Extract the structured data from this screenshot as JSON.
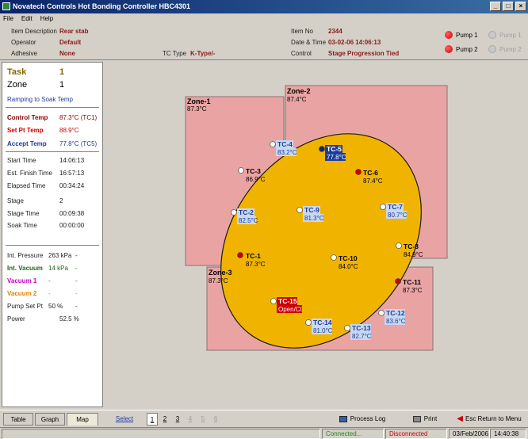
{
  "window": {
    "title": "Novatech Controls Hot Bonding Controller HBC4301"
  },
  "menu": [
    "File",
    "Edit",
    "Help"
  ],
  "header": {
    "item_description_label": "Item Description",
    "item_description": "Rear stab",
    "operator_label": "Operator",
    "operator": "Default",
    "adhesive_label": "Adhesive",
    "adhesive": "None",
    "tc_type_label": "TC Type",
    "tc_type": "K-Type/-",
    "item_no_label": "Item No",
    "item_no": "2344",
    "date_time_label": "Date & Time",
    "date_time": "03-02-06 14:06:13",
    "control_label": "Control",
    "control": "Stage Progression Tied",
    "pumps": [
      {
        "label": "Pump 1",
        "active": true
      },
      {
        "label": "Pump 1",
        "active": false
      },
      {
        "label": "Pump 2",
        "active": true
      },
      {
        "label": "Pump 2",
        "active": false
      }
    ]
  },
  "side": {
    "task_label": "Task",
    "task": "1",
    "zone_label": "Zone",
    "zone": "1",
    "status": "Ramping to Soak Temp",
    "control_temp_label": "Control Temp",
    "control_temp": "87.3°C (TC1)",
    "setpt_temp_label": "Set Pt Temp",
    "setpt_temp": "88.9°C",
    "accept_temp_label": "Accept Temp",
    "accept_temp": "77.8°C (TC5)",
    "start_time_label": "Start Time",
    "start_time": "14:06:13",
    "finish_time_label": "Est. Finish Time",
    "finish_time": "16:57:13",
    "elapsed_time_label": "Elapsed Time",
    "elapsed_time": "00:34:24",
    "stage_label": "Stage",
    "stage": "2",
    "stage_time_label": "Stage Time",
    "stage_time": "00:09:38",
    "soak_time_label": "Soak Time",
    "soak_time": "00:00:00",
    "int_pressure_label": "Int. Pressure",
    "int_pressure": "263 kPa",
    "int_pressure_extra": "-",
    "int_vacuum_label": "Int. Vacuum",
    "int_vacuum": "14 kPa",
    "int_vacuum_extra": "-",
    "vacuum1_label": "Vacuum 1",
    "vacuum1": "-",
    "vacuum1_extra": "-",
    "vacuum2_label": "Vacuum 2",
    "vacuum2": "-",
    "vacuum2_extra": "-",
    "pump_setpt_label": "Pump Set Pt",
    "pump_setpt": "50 %",
    "pump_setpt_extra": "-",
    "power_label": "Power",
    "power": "52.5 %"
  },
  "map": {
    "zones": [
      {
        "name": "Zone-1",
        "temp": "87.3°C"
      },
      {
        "name": "Zone-2",
        "temp": "87.4°C"
      },
      {
        "name": "Zone-3",
        "temp": "87.3°C"
      }
    ],
    "tcs": [
      {
        "id": "TC-1",
        "temp": "87.3°C",
        "dot": "#cc0000"
      },
      {
        "id": "TC-2",
        "temp": "82.5°C",
        "dot": "#ffffff"
      },
      {
        "id": "TC-3",
        "temp": "86.9°C",
        "dot": "#ffffff"
      },
      {
        "id": "TC-4",
        "temp": "83.2°C",
        "dot": "#ffffff"
      },
      {
        "id": "TC-5",
        "temp": "77.8°C",
        "dot": "#1a237e"
      },
      {
        "id": "TC-6",
        "temp": "87.4°C",
        "dot": "#cc0000"
      },
      {
        "id": "TC-7",
        "temp": "80.7°C",
        "dot": "#ffffff"
      },
      {
        "id": "TC-8",
        "temp": "84.9°C",
        "dot": "#ffffff"
      },
      {
        "id": "TC-9",
        "temp": "81.3°C",
        "dot": "#ffffff"
      },
      {
        "id": "TC-10",
        "temp": "84.0°C",
        "dot": "#ffffff"
      },
      {
        "id": "TC-11",
        "temp": "87.3°C",
        "dot": "#cc0000"
      },
      {
        "id": "TC-12",
        "temp": "83.6°C",
        "dot": "#ffffff"
      },
      {
        "id": "TC-13",
        "temp": "82.7°C",
        "dot": "#ffffff"
      },
      {
        "id": "TC-14",
        "temp": "81.0°C",
        "dot": "#ffffff"
      },
      {
        "id": "TC-15",
        "temp": "Open/Ct",
        "dot": "#ffffff"
      }
    ]
  },
  "tabs": [
    "Table",
    "Graph",
    "Map"
  ],
  "select_zone_label": "Select Zone",
  "zone_buttons": [
    "1",
    "2",
    "3",
    "4",
    "5",
    "6"
  ],
  "actions": {
    "process_log": "Process Log",
    "print": "Print",
    "esc": "Esc Return to Menu"
  },
  "status": {
    "connected": "Connected...",
    "disconnected": "Disconnected",
    "date": "03/Feb/2006",
    "time": "14:40:38"
  },
  "colors": {
    "zone_fill": "#eaa3a3",
    "part_fill": "#f0b400",
    "highlight_blue": "#1e3c9a",
    "alert_red": "#cc0000"
  }
}
